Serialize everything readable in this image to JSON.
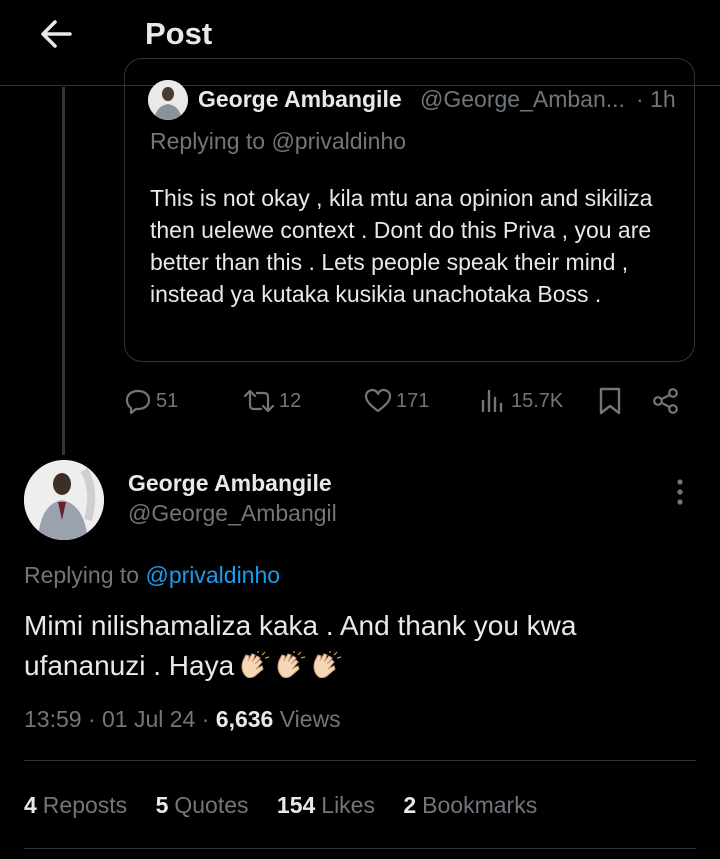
{
  "header": {
    "title": "Post",
    "back_icon": "arrow-left-icon"
  },
  "quoted_post": {
    "author_name": "George Ambangile",
    "author_handle": "@George_Amban...",
    "time": "· 1h",
    "replying_to": "Replying to @privaldinho",
    "text": "This is not okay , kila mtu ana opinion and sikiliza then uelewe context .  Dont do this Priva , you are better than this . Lets people speak their mind , instead ya kutaka kusikia unachotaka Boss ."
  },
  "actions": {
    "replies": "51",
    "reposts": "12",
    "likes": "171",
    "views": "15.7K"
  },
  "main_post": {
    "author_name": "George Ambangile",
    "author_handle": "@George_Ambangil",
    "replying_prefix": "Replying to ",
    "replying_mention": "@privaldinho",
    "text": "Mimi nilishamaliza kaka . And thank you kwa ufananuzi . Haya",
    "time": "13:59 · 01 Jul 24 · ",
    "views_count": "6,636",
    "views_label": " Views"
  },
  "stats": {
    "reposts_count": "4",
    "reposts_label": "Reposts",
    "quotes_count": "5",
    "quotes_label": "Quotes",
    "likes_count": "154",
    "likes_label": "Likes",
    "bookmarks_count": "2",
    "bookmarks_label": "Bookmarks"
  },
  "colors": {
    "background": "#000000",
    "text": "#e7e9ea",
    "muted": "#71767b",
    "accent": "#1d9bf0",
    "border": "#2f3336"
  }
}
